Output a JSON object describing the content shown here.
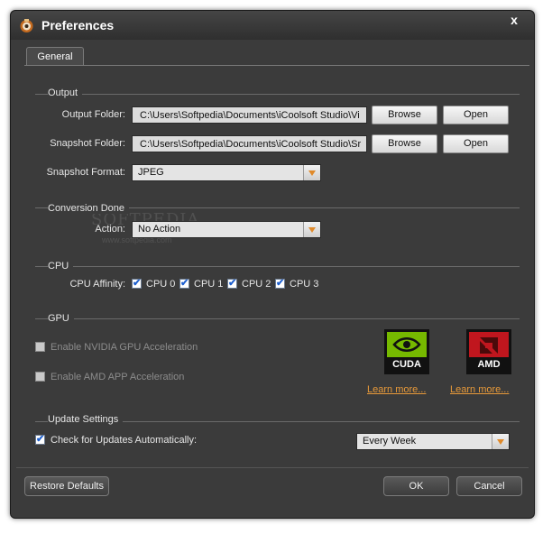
{
  "window": {
    "title": "Preferences",
    "close_label": "x"
  },
  "tabs": [
    {
      "label": "General"
    }
  ],
  "output": {
    "section_title": "Output",
    "output_folder_label": "Output Folder:",
    "output_folder_value": "C:\\Users\\Softpedia\\Documents\\iCoolsoft Studio\\Vi",
    "snapshot_folder_label": "Snapshot Folder:",
    "snapshot_folder_value": "C:\\Users\\Softpedia\\Documents\\iCoolsoft Studio\\Sr",
    "browse_label": "Browse",
    "open_label": "Open",
    "snapshot_format_label": "Snapshot Format:",
    "snapshot_format_value": "JPEG"
  },
  "conversion": {
    "section_title": "Conversion Done",
    "action_label": "Action:",
    "action_value": "No Action"
  },
  "cpu": {
    "section_title": "CPU",
    "affinity_label": "CPU Affinity:",
    "cores": [
      {
        "label": "CPU 0",
        "checked": true
      },
      {
        "label": "CPU 1",
        "checked": true
      },
      {
        "label": "CPU 2",
        "checked": true
      },
      {
        "label": "CPU 3",
        "checked": true
      }
    ]
  },
  "gpu": {
    "section_title": "GPU",
    "nvidia_label": "Enable NVIDIA GPU Acceleration",
    "amd_label": "Enable AMD APP Acceleration",
    "cuda_logo_text": "CUDA",
    "amd_logo_text": "AMD",
    "learn_more": "Learn more..."
  },
  "update": {
    "section_title": "Update Settings",
    "check_label": "Check for Updates Automatically:",
    "check_checked": true,
    "frequency_value": "Every Week"
  },
  "watermark": {
    "text": "SOFTPEDIA",
    "sub": "www.softpedia.com"
  },
  "footer": {
    "restore_label": "Restore Defaults",
    "ok_label": "OK",
    "cancel_label": "Cancel"
  },
  "colors": {
    "background": "#3b3b3b",
    "link": "#e89a3a",
    "accent_arrow": "#e08a2a",
    "cuda_green": "#76b900",
    "amd_red": "#c0161e"
  },
  "icons": [
    "app-icon",
    "close-icon",
    "dropdown-arrow-icon",
    "checkbox-icon",
    "cuda-logo",
    "amd-logo"
  ]
}
